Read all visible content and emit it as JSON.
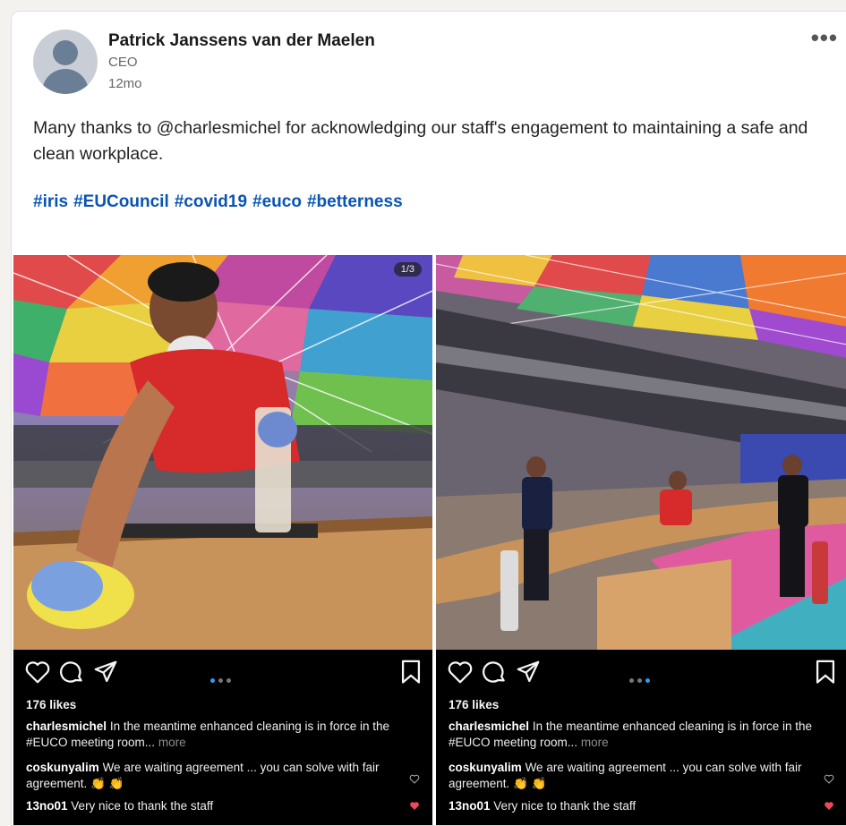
{
  "post": {
    "author": "Patrick Janssens van der Maelen",
    "headline": "CEO",
    "time": "12mo",
    "text": "Many thanks to @charlesmichel for acknowledging our staff's engagement to maintaining a safe and clean workplace.",
    "hashtags": [
      "#iris",
      "#EUCouncil",
      "#covid19",
      "#euco",
      "#betterness"
    ],
    "more_label": "•••"
  },
  "embeds": [
    {
      "counter": "1/3",
      "likes": "176 likes",
      "caption_user": "charlesmichel",
      "caption_text": "In the meantime enhanced cleaning is in force in the #EUCO meeting room...",
      "caption_more": "more",
      "comments": [
        {
          "user": "coskunyalim",
          "text": "We are waiting agreement ... you can solve with fair agreement. 👏 👏"
        },
        {
          "user": "13no01",
          "text": "Very nice to thank the staff"
        }
      ]
    },
    {
      "likes": "176 likes",
      "caption_user": "charlesmichel",
      "caption_text": "In the meantime enhanced cleaning is in force in the #EUCO meeting room...",
      "caption_more": "more",
      "comments": [
        {
          "user": "coskunyalim",
          "text": "We are waiting agreement ... you can solve with fair agreement. 👏 👏"
        },
        {
          "user": "13no01",
          "text": "Very nice to thank the staff"
        }
      ]
    }
  ],
  "icons": [
    "heart-icon",
    "comment-icon",
    "share-icon",
    "bookmark-icon",
    "more-icon"
  ],
  "colors": {
    "hashtag": "#0a54b3",
    "like_heart": "#ed4956",
    "carousel_active": "#3897f0"
  }
}
